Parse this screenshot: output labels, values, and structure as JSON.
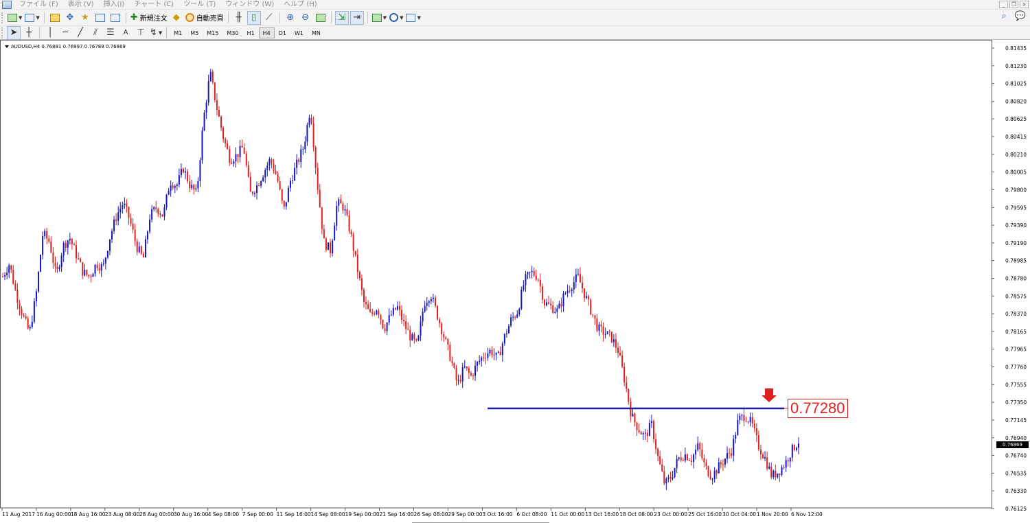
{
  "menu": {
    "items": [
      "ファイル (F)",
      "表示 (V)",
      "挿入(I)",
      "チャート (C)",
      "ツール (T)",
      "ウィンドウ (W)",
      "ヘルプ (H)"
    ]
  },
  "toolbar": {
    "new_order_label": "新規注文",
    "auto_trade_label": "自動売買",
    "timeframes": [
      "M1",
      "M5",
      "M15",
      "M30",
      "H1",
      "H4",
      "D1",
      "W1",
      "MN"
    ],
    "active_timeframe": "H4",
    "icons": {
      "new_chart": "new-chart-icon",
      "profiles": "profiles-icon",
      "market_watch": "market-watch-icon",
      "data_window": "data-window-icon",
      "navigator": "navigator-icon",
      "terminal": "terminal-icon",
      "tester": "strategy-tester-icon",
      "bar_chart": "bar-chart-icon",
      "candlestick": "candlestick-icon",
      "line_chart": "line-chart-icon",
      "zoom_in": "zoom-in-icon",
      "zoom_out": "zoom-out-icon",
      "tile": "tile-windows-icon",
      "autoscroll": "autoscroll-icon",
      "chart_shift": "chart-shift-icon",
      "indicators": "indicators-icon",
      "periods": "periods-clock-icon",
      "templates": "templates-icon",
      "search": "search-icon",
      "chat": "chat-icon"
    }
  },
  "drawing_tools": [
    "cursor-icon",
    "crosshair-icon",
    "vertical-line-icon",
    "horizontal-line-icon",
    "trendline-icon",
    "equidistant-channel-icon",
    "fibonacci-icon",
    "text-icon",
    "text-label-icon",
    "arrows-icon"
  ],
  "drawing_text_tool_label": "A",
  "chart": {
    "symbol_info": "AUDUSD,H4  0.76881 0.76997 0.76789 0.76869",
    "current_price": "0.76869",
    "annotation": "0.77280",
    "colors": {
      "bull": "#1414c8",
      "bear": "#e0201f",
      "hline": "#1c1c9c",
      "arrow": "#e0201f"
    },
    "price_labels": [
      "0.81435",
      "0.81230",
      "0.81025",
      "0.80820",
      "0.80625",
      "0.80415",
      "0.80210",
      "0.80005",
      "0.79800",
      "0.79595",
      "0.79390",
      "0.79190",
      "0.78985",
      "0.78780",
      "0.78575",
      "0.78370",
      "0.78165",
      "0.77965",
      "0.77760",
      "0.77555",
      "0.77350",
      "0.77145",
      "0.76940",
      "0.76740",
      "0.76535",
      "0.76330",
      "0.76125"
    ],
    "time_labels": [
      "11 Aug 2017",
      "16 Aug 00:00",
      "18 Aug 16:00",
      "23 Aug 08:00",
      "28 Aug 00:00",
      "30 Aug 16:00",
      "4 Sep 08:00",
      "7 Sep 00:00",
      "11 Sep 16:00",
      "14 Sep 08:00",
      "19 Sep 00:00",
      "21 Sep 16:00",
      "26 Sep 08:00",
      "29 Sep 00:00",
      "3 Oct 16:00",
      "6 Oct 08:00",
      "11 Oct 00:00",
      "13 Oct 16:00",
      "18 Oct 08:00",
      "23 Oct 00:00",
      "25 Oct 16:00",
      "30 Oct 04:00",
      "1 Nov 20:00",
      "6 Nov 12:00"
    ],
    "price_path": [
      [
        0,
        0.788
      ],
      [
        2,
        0.7895
      ],
      [
        4,
        0.786
      ],
      [
        6,
        0.7835
      ],
      [
        8,
        0.7815
      ],
      [
        10,
        0.786
      ],
      [
        12,
        0.793
      ],
      [
        14,
        0.792
      ],
      [
        16,
        0.788
      ],
      [
        18,
        0.7915
      ],
      [
        20,
        0.7925
      ],
      [
        22,
        0.7905
      ],
      [
        24,
        0.7885
      ],
      [
        26,
        0.788
      ],
      [
        28,
        0.7895
      ],
      [
        30,
        0.789
      ],
      [
        32,
        0.7925
      ],
      [
        34,
        0.795
      ],
      [
        36,
        0.7965
      ],
      [
        38,
        0.7945
      ],
      [
        40,
        0.7915
      ],
      [
        42,
        0.79
      ],
      [
        44,
        0.795
      ],
      [
        46,
        0.796
      ],
      [
        48,
        0.795
      ],
      [
        50,
        0.799
      ],
      [
        52,
        0.7985
      ],
      [
        54,
        0.8005
      ],
      [
        56,
        0.7985
      ],
      [
        58,
        0.7975
      ],
      [
        60,
        0.806
      ],
      [
        62,
        0.8115
      ],
      [
        64,
        0.8075
      ],
      [
        66,
        0.804
      ],
      [
        68,
        0.8015
      ],
      [
        70,
        0.802
      ],
      [
        72,
        0.803
      ],
      [
        74,
        0.7975
      ],
      [
        76,
        0.7985
      ],
      [
        78,
        0.8
      ],
      [
        80,
        0.8015
      ],
      [
        82,
        0.7995
      ],
      [
        84,
        0.7955
      ],
      [
        86,
        0.799
      ],
      [
        88,
        0.801
      ],
      [
        90,
        0.803
      ],
      [
        92,
        0.8075
      ],
      [
        94,
        0.799
      ],
      [
        96,
        0.792
      ],
      [
        98,
        0.791
      ],
      [
        100,
        0.7965
      ],
      [
        102,
        0.796
      ],
      [
        104,
        0.793
      ],
      [
        106,
        0.789
      ],
      [
        108,
        0.785
      ],
      [
        110,
        0.7835
      ],
      [
        112,
        0.7845
      ],
      [
        114,
        0.782
      ],
      [
        116,
        0.7835
      ],
      [
        118,
        0.7845
      ],
      [
        120,
        0.7825
      ],
      [
        122,
        0.781
      ],
      [
        124,
        0.78
      ],
      [
        126,
        0.785
      ],
      [
        128,
        0.786
      ],
      [
        130,
        0.7835
      ],
      [
        132,
        0.781
      ],
      [
        134,
        0.7785
      ],
      [
        136,
        0.7755
      ],
      [
        138,
        0.7775
      ],
      [
        140,
        0.7765
      ],
      [
        142,
        0.778
      ],
      [
        144,
        0.779
      ],
      [
        146,
        0.7795
      ],
      [
        148,
        0.7785
      ],
      [
        150,
        0.781
      ],
      [
        152,
        0.783
      ],
      [
        154,
        0.784
      ],
      [
        156,
        0.7875
      ],
      [
        158,
        0.7885
      ],
      [
        160,
        0.788
      ],
      [
        162,
        0.785
      ],
      [
        164,
        0.7845
      ],
      [
        166,
        0.784
      ],
      [
        168,
        0.786
      ],
      [
        170,
        0.787
      ],
      [
        172,
        0.788
      ],
      [
        174,
        0.786
      ],
      [
        176,
        0.784
      ],
      [
        178,
        0.782
      ],
      [
        180,
        0.7815
      ],
      [
        182,
        0.781
      ],
      [
        184,
        0.7795
      ],
      [
        186,
        0.776
      ],
      [
        188,
        0.772
      ],
      [
        190,
        0.7705
      ],
      [
        192,
        0.7695
      ],
      [
        194,
        0.771
      ],
      [
        196,
        0.767
      ],
      [
        198,
        0.764
      ],
      [
        200,
        0.765
      ],
      [
        202,
        0.767
      ],
      [
        204,
        0.7675
      ],
      [
        206,
        0.767
      ],
      [
        208,
        0.7685
      ],
      [
        210,
        0.766
      ],
      [
        212,
        0.765
      ],
      [
        214,
        0.766
      ],
      [
        216,
        0.767
      ],
      [
        218,
        0.768
      ],
      [
        220,
        0.7715
      ],
      [
        222,
        0.772
      ],
      [
        224,
        0.771
      ],
      [
        226,
        0.7685
      ],
      [
        228,
        0.767
      ],
      [
        230,
        0.765
      ],
      [
        232,
        0.7655
      ],
      [
        234,
        0.7665
      ],
      [
        236,
        0.768
      ],
      [
        238,
        0.769
      ]
    ],
    "hline_price": 0.7728,
    "price_axis_range": [
      0.76125,
      0.81435
    ]
  }
}
